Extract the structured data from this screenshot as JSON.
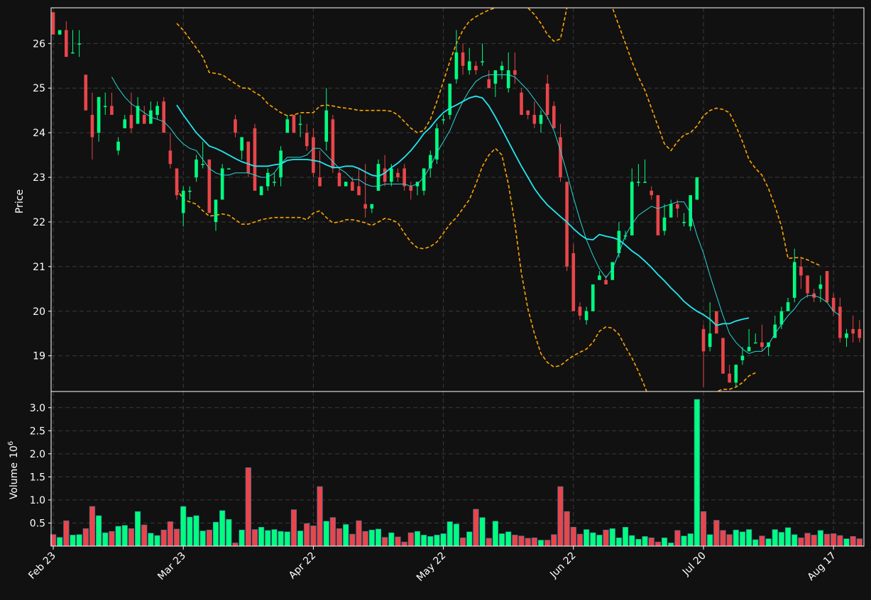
{
  "colors": {
    "background": "#111111",
    "up": "#00ff7f",
    "down": "#e8464b",
    "ma_fast": "#22e7f0",
    "ma_slow": "#2ad6d6",
    "bands": "#ffa500",
    "grid": "#3a3a3a",
    "text": "#ffffff",
    "axis": "#ffffff"
  },
  "chart_data": {
    "type": "candlestick",
    "price_panel": {
      "ylabel": "Price",
      "ylim": [
        18.2,
        26.8
      ],
      "yticks": [
        19,
        20,
        21,
        22,
        23,
        24,
        25,
        26
      ],
      "grid": true
    },
    "volume_panel": {
      "ylabel": "Volume",
      "ylabel_exponent": "6",
      "ylim": [
        0,
        3.35
      ],
      "yticks": [
        0.5,
        1.0,
        1.5,
        2.0,
        2.5,
        3.0
      ],
      "ytick_labels": [
        "0.5",
        "1.0",
        "1.5",
        "2.0",
        "2.5",
        "3.0"
      ],
      "grid": true
    },
    "xtick_labels": [
      "Feb 23",
      "Mar 23",
      "Apr 22",
      "May 22",
      "Jun 22",
      "Jul 20",
      "Aug 17"
    ],
    "xtick_index": [
      0,
      20,
      40,
      60,
      80,
      100,
      120
    ],
    "ohlc": [
      [
        26.7,
        26.7,
        26.2,
        26.2
      ],
      [
        26.2,
        26.3,
        26.2,
        26.3
      ],
      [
        26.3,
        26.5,
        25.7,
        25.7
      ],
      [
        25.8,
        26.3,
        25.8,
        25.8
      ],
      [
        26.0,
        26.3,
        25.7,
        26.0
      ],
      [
        25.3,
        25.3,
        24.5,
        24.5
      ],
      [
        24.4,
        24.9,
        23.4,
        23.9
      ],
      [
        24.0,
        24.8,
        23.8,
        24.8
      ],
      [
        24.6,
        24.9,
        24.4,
        24.6
      ],
      [
        24.6,
        24.9,
        24.4,
        24.4
      ],
      [
        23.6,
        23.9,
        23.5,
        23.8
      ],
      [
        24.1,
        24.4,
        24.1,
        24.3
      ],
      [
        24.4,
        24.9,
        24.0,
        24.1
      ],
      [
        24.2,
        24.8,
        24.2,
        24.6
      ],
      [
        24.4,
        24.6,
        24.2,
        24.2
      ],
      [
        24.2,
        24.7,
        24.2,
        24.5
      ],
      [
        24.4,
        24.7,
        24.3,
        24.6
      ],
      [
        24.7,
        24.8,
        24.0,
        24.0
      ],
      [
        23.6,
        24.0,
        23.2,
        23.3
      ],
      [
        23.2,
        23.2,
        22.5,
        22.6
      ],
      [
        22.2,
        22.8,
        21.9,
        22.7
      ],
      [
        22.7,
        22.8,
        22.5,
        22.7
      ],
      [
        23.0,
        23.5,
        22.9,
        23.4
      ],
      [
        23.3,
        23.8,
        23.2,
        23.3
      ],
      [
        23.4,
        23.4,
        22.2,
        22.2
      ],
      [
        22.0,
        22.5,
        21.8,
        22.5
      ],
      [
        22.5,
        23.3,
        22.5,
        23.2
      ],
      [
        23.2,
        23.2,
        23.2,
        23.2
      ],
      [
        24.3,
        24.4,
        23.9,
        24.0
      ],
      [
        23.6,
        23.9,
        23.4,
        23.9
      ],
      [
        23.8,
        23.8,
        23.0,
        23.1
      ],
      [
        24.1,
        24.2,
        22.7,
        22.7
      ],
      [
        22.6,
        22.8,
        22.6,
        22.8
      ],
      [
        22.8,
        23.2,
        22.7,
        23.1
      ],
      [
        22.9,
        23.1,
        22.8,
        22.9
      ],
      [
        23.0,
        23.7,
        22.8,
        23.6
      ],
      [
        24.0,
        24.4,
        24.0,
        24.3
      ],
      [
        24.4,
        24.4,
        24.0,
        24.0
      ],
      [
        24.2,
        24.4,
        23.9,
        24.2
      ],
      [
        24.0,
        24.2,
        23.6,
        23.7
      ],
      [
        23.9,
        24.1,
        23.0,
        23.1
      ],
      [
        23.0,
        23.6,
        22.8,
        22.8
      ],
      [
        23.8,
        25.0,
        23.6,
        24.5
      ],
      [
        24.3,
        24.4,
        23.1,
        23.2
      ],
      [
        23.1,
        23.2,
        22.8,
        22.8
      ],
      [
        22.8,
        22.9,
        22.8,
        22.9
      ],
      [
        22.9,
        23.0,
        22.7,
        22.7
      ],
      [
        22.8,
        23.2,
        22.6,
        22.6
      ],
      [
        22.4,
        23.3,
        22.1,
        22.3
      ],
      [
        22.3,
        22.4,
        22.2,
        22.4
      ],
      [
        22.7,
        23.4,
        22.7,
        23.3
      ],
      [
        23.2,
        23.5,
        22.8,
        22.9
      ],
      [
        22.9,
        23.3,
        22.8,
        23.2
      ],
      [
        23.1,
        23.2,
        22.9,
        23.0
      ],
      [
        23.2,
        23.3,
        22.7,
        22.8
      ],
      [
        22.8,
        22.9,
        22.5,
        22.7
      ],
      [
        22.8,
        22.9,
        22.6,
        22.9
      ],
      [
        22.7,
        23.2,
        22.6,
        23.2
      ],
      [
        23.2,
        23.6,
        23.0,
        23.5
      ],
      [
        23.4,
        24.2,
        23.3,
        24.1
      ],
      [
        24.3,
        24.4,
        24.2,
        24.3
      ],
      [
        24.4,
        25.1,
        24.3,
        25.1
      ],
      [
        25.2,
        26.3,
        25.1,
        25.8
      ],
      [
        25.8,
        26.0,
        25.3,
        25.5
      ],
      [
        25.4,
        25.9,
        25.3,
        25.6
      ],
      [
        25.5,
        25.6,
        25.3,
        25.4
      ],
      [
        25.6,
        26.0,
        25.5,
        25.6
      ],
      [
        25.2,
        25.4,
        25.0,
        25.0
      ],
      [
        25.1,
        25.4,
        24.8,
        25.4
      ],
      [
        25.4,
        25.6,
        25.2,
        25.5
      ],
      [
        25.0,
        25.8,
        24.9,
        25.4
      ],
      [
        25.4,
        25.8,
        25.1,
        25.3
      ],
      [
        24.9,
        25.0,
        24.4,
        24.4
      ],
      [
        24.5,
        24.5,
        24.3,
        24.4
      ],
      [
        24.4,
        24.7,
        24.1,
        24.2
      ],
      [
        24.2,
        24.5,
        24.0,
        24.4
      ],
      [
        25.1,
        25.3,
        24.3,
        24.4
      ],
      [
        24.6,
        24.7,
        24.1,
        24.1
      ],
      [
        23.9,
        24.2,
        22.9,
        23.0
      ],
      [
        22.9,
        22.9,
        20.9,
        21.0
      ],
      [
        21.3,
        21.5,
        20.0,
        20.0
      ],
      [
        20.1,
        20.2,
        19.8,
        19.9
      ],
      [
        19.8,
        20.1,
        19.7,
        20.0
      ],
      [
        20.0,
        20.6,
        20.0,
        20.6
      ],
      [
        20.7,
        20.9,
        20.7,
        20.8
      ],
      [
        20.7,
        20.8,
        20.6,
        20.6
      ],
      [
        20.7,
        21.1,
        20.7,
        21.1
      ],
      [
        21.3,
        22.0,
        21.2,
        21.8
      ],
      [
        21.7,
        21.8,
        21.6,
        21.7
      ],
      [
        21.7,
        23.2,
        21.7,
        22.9
      ],
      [
        22.9,
        23.3,
        22.8,
        22.9
      ],
      [
        22.9,
        23.4,
        22.9,
        22.9
      ],
      [
        22.7,
        22.8,
        22.5,
        22.6
      ],
      [
        22.6,
        22.6,
        21.7,
        21.7
      ],
      [
        21.8,
        22.4,
        21.7,
        22.1
      ],
      [
        22.1,
        22.5,
        22.1,
        22.4
      ],
      [
        22.4,
        22.5,
        22.1,
        22.3
      ],
      [
        22.0,
        22.2,
        21.9,
        22.0
      ],
      [
        21.9,
        22.6,
        21.8,
        22.6
      ],
      [
        22.5,
        23.0,
        22.5,
        23.0
      ],
      [
        19.6,
        19.7,
        18.3,
        19.1
      ],
      [
        19.2,
        20.2,
        19.1,
        19.5
      ],
      [
        20.0,
        20.0,
        19.5,
        19.5
      ],
      [
        19.4,
        19.4,
        18.6,
        18.6
      ],
      [
        18.6,
        18.8,
        18.4,
        18.4
      ],
      [
        18.4,
        18.8,
        18.3,
        18.8
      ],
      [
        18.9,
        19.2,
        18.8,
        19.0
      ],
      [
        19.1,
        19.6,
        19.1,
        19.2
      ],
      [
        19.3,
        19.5,
        19.3,
        19.3
      ],
      [
        19.3,
        19.7,
        19.1,
        19.2
      ],
      [
        19.2,
        19.3,
        19.0,
        19.3
      ],
      [
        19.4,
        19.9,
        19.4,
        19.7
      ],
      [
        19.7,
        20.1,
        19.6,
        20.0
      ],
      [
        20.0,
        20.3,
        20.0,
        20.2
      ],
      [
        20.3,
        21.4,
        20.2,
        21.1
      ],
      [
        21.0,
        21.2,
        20.5,
        20.8
      ],
      [
        20.8,
        20.8,
        20.3,
        20.4
      ],
      [
        20.4,
        20.5,
        20.2,
        20.3
      ],
      [
        20.5,
        20.8,
        20.2,
        20.6
      ],
      [
        20.9,
        20.9,
        20.2,
        20.2
      ],
      [
        20.3,
        20.4,
        19.9,
        20.0
      ],
      [
        20.1,
        20.3,
        19.3,
        19.4
      ],
      [
        19.4,
        19.6,
        19.2,
        19.5
      ],
      [
        19.6,
        19.9,
        19.3,
        19.5
      ],
      [
        19.6,
        19.8,
        19.3,
        19.4
      ],
      [
        19.6,
        19.9,
        19.3,
        19.7
      ]
    ],
    "volume": [
      0.25,
      0.19,
      0.55,
      0.24,
      0.25,
      0.38,
      0.86,
      0.66,
      0.29,
      0.32,
      0.43,
      0.45,
      0.38,
      0.75,
      0.46,
      0.28,
      0.23,
      0.35,
      0.53,
      0.37,
      0.86,
      0.63,
      0.66,
      0.33,
      0.35,
      0.52,
      0.77,
      0.58,
      0.07,
      0.35,
      1.7,
      0.36,
      0.41,
      0.34,
      0.36,
      0.32,
      0.31,
      0.79,
      0.33,
      0.49,
      0.44,
      1.29,
      0.54,
      0.62,
      0.38,
      0.47,
      0.26,
      0.55,
      0.32,
      0.35,
      0.37,
      0.19,
      0.29,
      0.2,
      0.09,
      0.29,
      0.32,
      0.24,
      0.21,
      0.24,
      0.27,
      0.53,
      0.48,
      0.18,
      0.31,
      0.8,
      0.62,
      0.17,
      0.54,
      0.27,
      0.31,
      0.24,
      0.22,
      0.17,
      0.18,
      0.13,
      0.13,
      0.25,
      1.29,
      0.75,
      0.41,
      0.26,
      0.36,
      0.29,
      0.24,
      0.35,
      0.38,
      0.18,
      0.41,
      0.23,
      0.15,
      0.21,
      0.18,
      0.09,
      0.18,
      0.07,
      0.34,
      0.22,
      0.27,
      3.18,
      0.75,
      0.25,
      0.56,
      0.34,
      0.25,
      0.35,
      0.31,
      0.36,
      0.14,
      0.22,
      0.16,
      0.36,
      0.3,
      0.4,
      0.25,
      0.18,
      0.28,
      0.24,
      0.34,
      0.26,
      0.27,
      0.23,
      0.16,
      0.21,
      0.16
    ],
    "ma_fast": [
      null,
      null,
      null,
      null,
      null,
      null,
      null,
      null,
      null,
      25.25,
      25.0,
      24.8,
      24.65,
      24.55,
      24.45,
      24.35,
      24.3,
      24.25,
      24.1,
      23.9,
      23.75,
      23.65,
      23.6,
      23.4,
      23.2,
      23.1,
      23.05,
      23.05,
      23.1,
      23.1,
      23.1,
      23.05,
      23.0,
      23.0,
      23.1,
      23.3,
      23.45,
      23.45,
      23.45,
      23.5,
      23.65,
      23.65,
      23.5,
      23.35,
      23.2,
      23.1,
      22.95,
      22.95,
      22.85,
      22.8,
      22.8,
      22.85,
      22.85,
      22.85,
      22.85,
      22.8,
      22.85,
      23.0,
      23.25,
      23.55,
      23.8,
      24.05,
      24.4,
      24.7,
      24.95,
      25.15,
      25.25,
      25.3,
      25.3,
      25.3,
      25.3,
      25.25,
      25.1,
      24.95,
      24.75,
      24.55,
      24.35,
      24.05,
      23.6,
      23.1,
      22.55,
      22.05,
      21.6,
      21.25,
      20.95,
      20.75,
      20.95,
      21.3,
      21.7,
      21.95,
      22.15,
      22.25,
      22.35,
      22.3,
      22.35,
      22.4,
      22.45,
      22.45,
      22.2,
      21.7,
      21.3,
      20.8,
      20.35,
      19.9,
      19.5,
      19.3,
      19.15,
      19.05,
      19.1,
      19.1,
      19.25,
      19.5,
      19.7,
      19.9,
      20.05,
      20.25,
      20.35,
      20.35,
      20.3,
      20.2,
      20.0,
      19.9
    ],
    "ma_slow": [
      null,
      null,
      null,
      null,
      null,
      null,
      null,
      null,
      null,
      null,
      null,
      null,
      null,
      null,
      null,
      null,
      null,
      null,
      null,
      24.62,
      24.4,
      24.2,
      24.0,
      23.85,
      23.7,
      23.65,
      23.58,
      23.5,
      23.42,
      23.35,
      23.3,
      23.25,
      23.25,
      23.25,
      23.28,
      23.3,
      23.38,
      23.4,
      23.4,
      23.4,
      23.38,
      23.35,
      23.28,
      23.22,
      23.22,
      23.25,
      23.25,
      23.2,
      23.12,
      23.05,
      23.02,
      23.1,
      23.22,
      23.32,
      23.45,
      23.6,
      23.78,
      23.98,
      24.12,
      24.3,
      24.45,
      24.55,
      24.62,
      24.7,
      24.78,
      24.82,
      24.78,
      24.6,
      24.35,
      24.08,
      23.8,
      23.52,
      23.25,
      23.0,
      22.75,
      22.55,
      22.38,
      22.25,
      22.12,
      22.0,
      21.85,
      21.72,
      21.62,
      21.6,
      21.72,
      21.68,
      21.65,
      21.6,
      21.48,
      21.35,
      21.25,
      21.12,
      20.98,
      20.82,
      20.68,
      20.52,
      20.38,
      20.22,
      20.1,
      20.0,
      19.92,
      19.82,
      19.68,
      19.72,
      19.72,
      19.78,
      19.82,
      19.85
    ],
    "band_upper": [
      26.45,
      26.3,
      26.1,
      25.9,
      25.7,
      25.35,
      25.33,
      25.3,
      25.2,
      25.1,
      25.0,
      25.0,
      24.9,
      24.82,
      24.65,
      24.55,
      24.45,
      24.38,
      24.4,
      24.45,
      24.45,
      24.45,
      24.6,
      24.62,
      24.6,
      24.57,
      24.55,
      24.53,
      24.5,
      24.5,
      24.5,
      24.5,
      24.5,
      24.48,
      24.4,
      24.25,
      24.1,
      24.0,
      24.05,
      24.3,
      24.7,
      25.15,
      25.6,
      26.0,
      26.3,
      26.5,
      26.6,
      26.68,
      26.75,
      26.8,
      26.85,
      26.9,
      26.9,
      26.88,
      26.8,
      26.65,
      26.45,
      26.2,
      26.05,
      26.1,
      26.8,
      28.0,
      28.8,
      28.8,
      28.5,
      27.9,
      27.3,
      26.8,
      26.4,
      26.0,
      25.6,
      25.25,
      24.95,
      24.55,
      24.15,
      23.75,
      23.6,
      23.8,
      23.95,
      24.0,
      24.15,
      24.38,
      24.5,
      24.55,
      24.52,
      24.45,
      24.15,
      23.8,
      23.4,
      23.2,
      23.05,
      22.75,
      22.35,
      21.9,
      21.18,
      21.2,
      21.2,
      21.15,
      21.08,
      21.02
    ],
    "band_lower": [
      22.75,
      22.5,
      22.45,
      22.4,
      22.25,
      22.13,
      22.15,
      22.18,
      22.15,
      22.05,
      21.95,
      21.95,
      22.0,
      22.05,
      22.08,
      22.1,
      22.1,
      22.1,
      22.1,
      22.1,
      22.05,
      22.2,
      22.25,
      22.1,
      21.98,
      22.0,
      22.05,
      22.05,
      22.02,
      21.98,
      21.92,
      22.0,
      22.08,
      22.05,
      21.98,
      21.75,
      21.55,
      21.42,
      21.4,
      21.45,
      21.55,
      21.75,
      21.95,
      22.1,
      22.3,
      22.5,
      22.85,
      23.25,
      23.5,
      23.65,
      23.5,
      22.85,
      21.95,
      20.85,
      20.05,
      19.5,
      19.05,
      18.85,
      18.75,
      18.78,
      18.9,
      19.0,
      19.08,
      19.15,
      19.3,
      19.55,
      19.65,
      19.62,
      19.48,
      19.2,
      18.95,
      18.65,
      18.3,
      17.9,
      17.6,
      17.55,
      17.58,
      17.7,
      17.85,
      17.95,
      18.05,
      18.1,
      18.1,
      18.2,
      18.25,
      18.25,
      18.3,
      18.4,
      18.55,
      18.62
    ],
    "band_upper_start": 19,
    "band_lower_start": 19
  }
}
